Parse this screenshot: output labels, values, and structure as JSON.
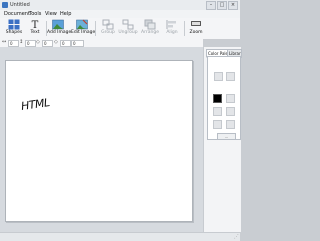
{
  "window": {
    "title": "Untitled"
  },
  "window_buttons": {
    "minimize": "–",
    "maximize": "□",
    "close": "×"
  },
  "menu": {
    "items": [
      "Document",
      "Tools",
      "View",
      "Help"
    ]
  },
  "toolbar": {
    "shapes": "Shapes",
    "text": "Text",
    "add_image": "Add Image",
    "edit_image": "Edit Image",
    "group": "Group",
    "ungroup": "Ungroup",
    "arrange": "Arrange",
    "align": "Align",
    "zoom": "Zoom"
  },
  "properties": {
    "field1": "0",
    "field2": "0",
    "field3": "0",
    "field4": "0",
    "field5": "0"
  },
  "canvas": {
    "text": "HTML"
  },
  "panel": {
    "tabs": [
      "Color Palette",
      "Library"
    ],
    "colors": {
      "selected": "#000000",
      "empty": "#e3e5e8"
    },
    "button_label": "..."
  },
  "icons": {
    "shapes": "shapes-icon",
    "text": "text-icon",
    "add_image": "add-image-icon",
    "edit_image": "edit-image-icon",
    "group": "group-icon",
    "ungroup": "ungroup-icon",
    "arrange": "arrange-icon",
    "align": "align-icon",
    "zoom": "zoom-icon"
  }
}
